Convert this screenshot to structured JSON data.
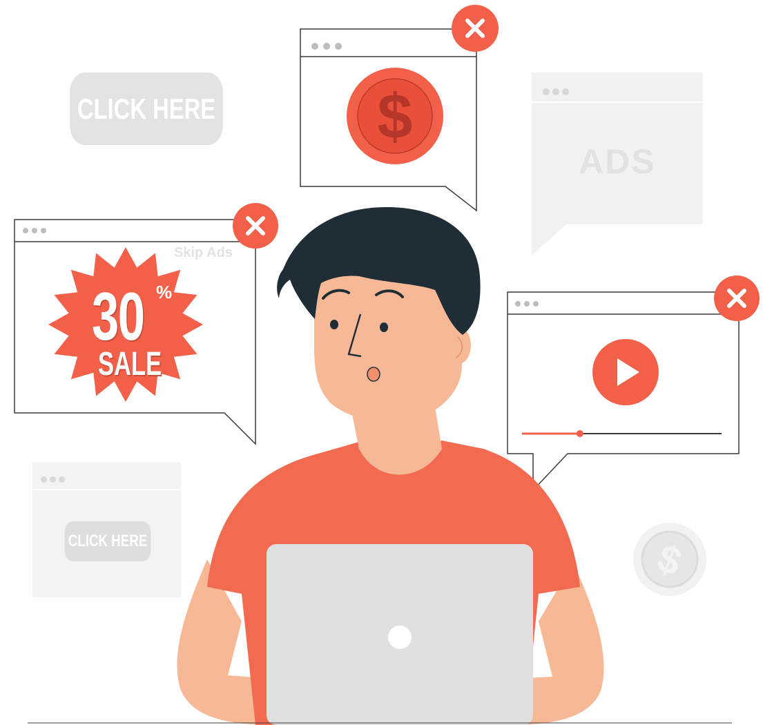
{
  "ghost_buttons": {
    "top_label": "CLICK HERE",
    "bottom_label": "CLICK HERE"
  },
  "ads_window": {
    "label": "ADS"
  },
  "sale_popup": {
    "skip_label": "Skip Ads",
    "discount_number": "30",
    "percent_sign": "%",
    "sale_word": "SALE"
  },
  "icons": {
    "close": "close-icon",
    "dollar": "dollar-coin-icon",
    "play": "play-icon"
  },
  "video_popup": {
    "progress_fraction": 0.29
  },
  "colors": {
    "accent": "#f2604a",
    "skin": "#f7b896",
    "hair": "#1f2d36",
    "laptop": "#e0e0e0"
  }
}
